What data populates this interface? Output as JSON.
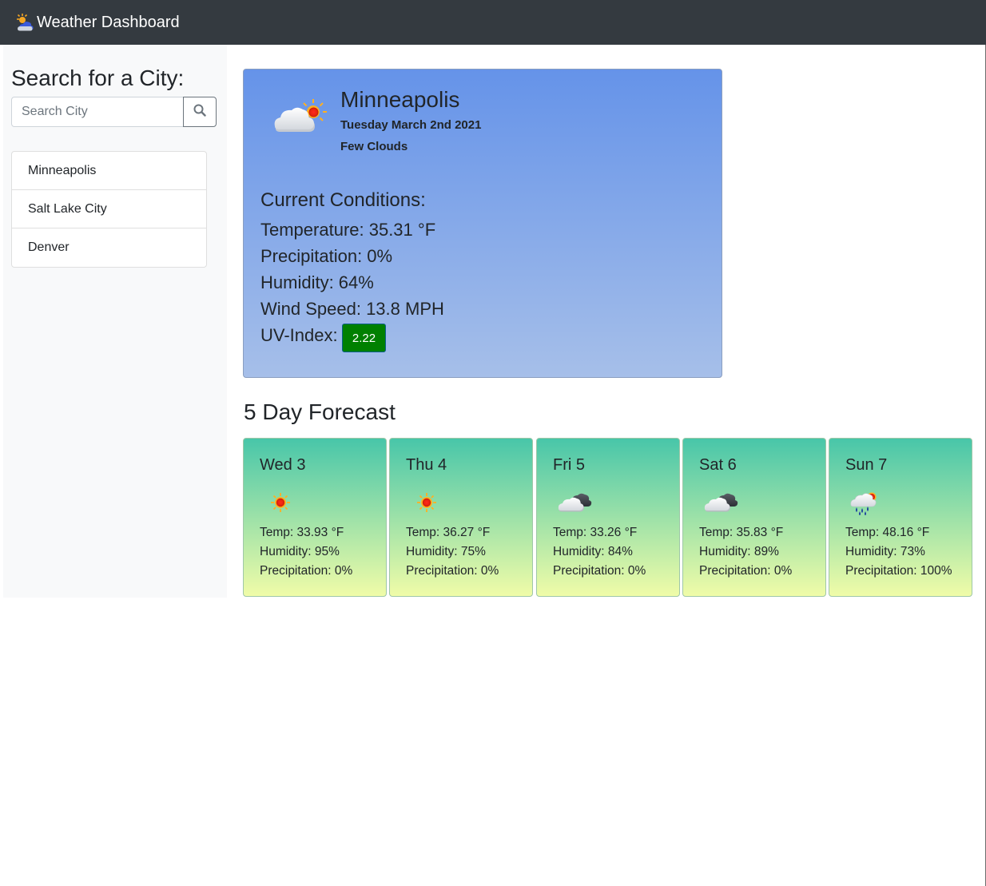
{
  "app": {
    "title": "Weather Dashboard",
    "brand_icon": "cloud-sun-icon"
  },
  "sidebar": {
    "heading": "Search for a City:",
    "search": {
      "placeholder": "Search City",
      "value": "",
      "button_icon": "search-icon"
    },
    "cities": [
      "Minneapolis",
      "Salt Lake City",
      "Denver"
    ]
  },
  "current": {
    "city": "Minneapolis",
    "date": "Tuesday March 2nd 2021",
    "description": "Few Clouds",
    "icon": "few-clouds-day-icon",
    "conditions_heading": "Current Conditions:",
    "temperature": "Temperature: 35.31 °F",
    "precipitation": "Precipitation: 0%",
    "humidity": "Humidity: 64%",
    "wind": "Wind Speed: 13.8 MPH",
    "uv_label": "UV-Index:",
    "uv_value": "2.22",
    "uv_color": "#008000"
  },
  "forecast": {
    "heading": "5 Day Forecast",
    "days": [
      {
        "day": "Wed 3",
        "icon": "sun-icon",
        "temp": "Temp: 33.93 °F",
        "humidity": "Humidity: 95%",
        "precip": "Precipitation: 0%"
      },
      {
        "day": "Thu 4",
        "icon": "sun-icon",
        "temp": "Temp: 36.27 °F",
        "humidity": "Humidity: 75%",
        "precip": "Precipitation: 0%"
      },
      {
        "day": "Fri 5",
        "icon": "broken-clouds-icon",
        "temp": "Temp: 33.26 °F",
        "humidity": "Humidity: 84%",
        "precip": "Precipitation: 0%"
      },
      {
        "day": "Sat 6",
        "icon": "broken-clouds-icon",
        "temp": "Temp: 35.83 °F",
        "humidity": "Humidity: 89%",
        "precip": "Precipitation: 0%"
      },
      {
        "day": "Sun 7",
        "icon": "rain-icon",
        "temp": "Temp: 48.16 °F",
        "humidity": "Humidity: 73%",
        "precip": "Precipitation: 100%"
      }
    ]
  },
  "colors": {
    "navbar": "#343a40",
    "sidebar": "#f8f9fa",
    "current_card_top": "#6593e9",
    "current_card_bottom": "#a6bfe9",
    "forecast_card_top": "#48c6a9",
    "forecast_card_bottom": "#f0fca8"
  }
}
